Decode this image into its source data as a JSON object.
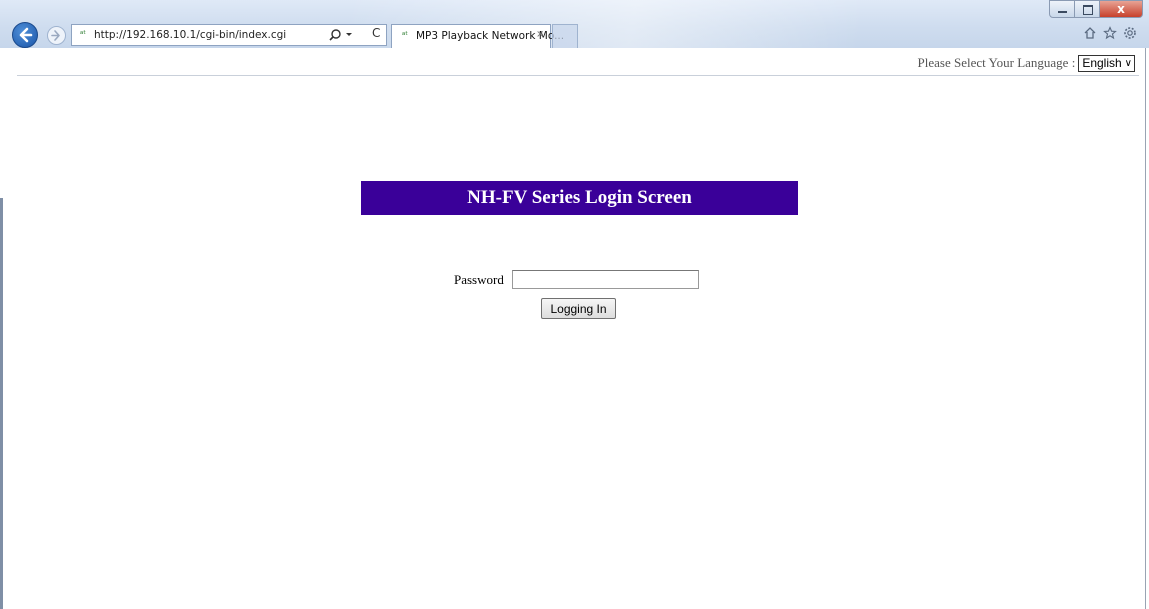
{
  "browser": {
    "url": "http://192.168.10.1/cgi-bin/index.cgi",
    "tab_title": "MP3 Playback Network Mo...",
    "tab_close": "×",
    "favicon_glyph": "ᵃᵗ",
    "refresh_glyph": "C",
    "window_close_glyph": "x",
    "toolbar_icons": [
      "home-icon",
      "favorites-star-icon",
      "settings-gear-icon"
    ]
  },
  "header": {
    "language_label": "Please Select Your Language :",
    "language_selected": "English"
  },
  "login": {
    "title": "NH-FV Series Login Screen",
    "password_label": "Password",
    "password_value": "",
    "submit_label": "Logging In"
  },
  "colors": {
    "banner": "#3a0099",
    "banner_text": "#ffffff",
    "back_button": "#2a66c0"
  }
}
